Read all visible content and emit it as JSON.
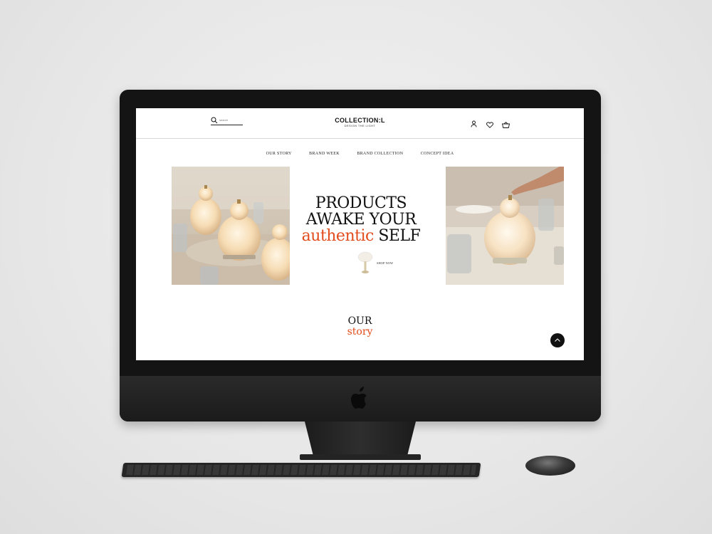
{
  "brand": {
    "name": "COLLECTION:L",
    "tagline": "DESIGN THE LIGHT"
  },
  "search": {
    "placeholder": "search"
  },
  "header_icons": [
    "user-icon",
    "heart-icon",
    "basket-icon"
  ],
  "nav": {
    "items": [
      "OUR STORY",
      "BRAND WEEK",
      "BRAND COLLECTION",
      "CONCEPT IDEA"
    ]
  },
  "hero": {
    "line1": "PRODUCTS",
    "line2": "AWAKE YOUR",
    "accent_word": "authentic",
    "line3_rest": "SELF",
    "cta": "SHOP NOW"
  },
  "story": {
    "title_top": "OUR",
    "title_bottom": "story"
  },
  "colors": {
    "accent": "#e24b1c",
    "text": "#111111",
    "monitor": "#141414"
  }
}
